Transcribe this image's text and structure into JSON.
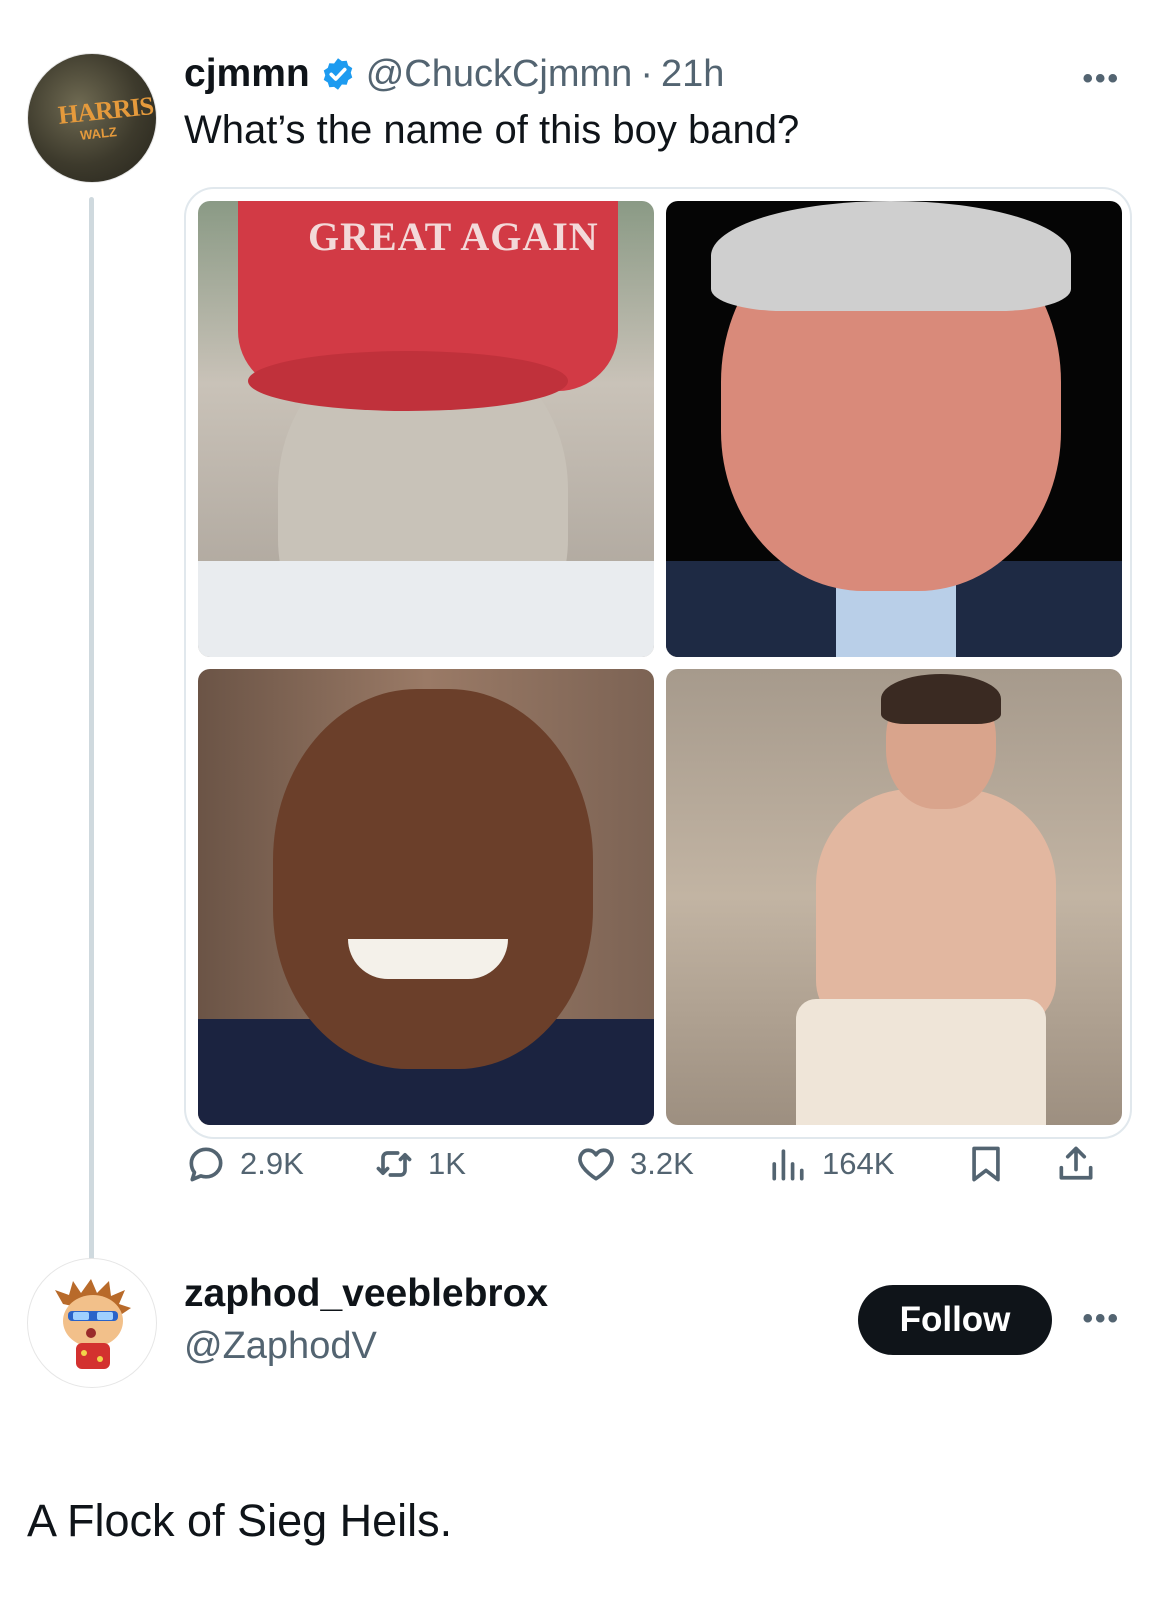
{
  "colors": {
    "verified": "#1d9bf0",
    "follow_bg": "#0f1419",
    "secondary_text": "#536471"
  },
  "tweet": {
    "avatar_text_top": "HARRIS",
    "avatar_text_bottom": "WALZ",
    "display_name": "cjmmn",
    "handle": "@ChuckCjmmn",
    "separator": "·",
    "time": "21h",
    "more": "•••",
    "text": "What’s the name of this boy band?",
    "photo1_cap_text": "GREAT AGAIN",
    "stats": {
      "replies": "2.9K",
      "retweets": "1K",
      "likes": "3.2K",
      "views": "164K"
    }
  },
  "reply": {
    "display_name": "zaphod_veeblebrox",
    "handle": "@ZaphodV",
    "follow_label": "Follow",
    "more": "•••",
    "text": "A Flock of Sieg Heils."
  }
}
